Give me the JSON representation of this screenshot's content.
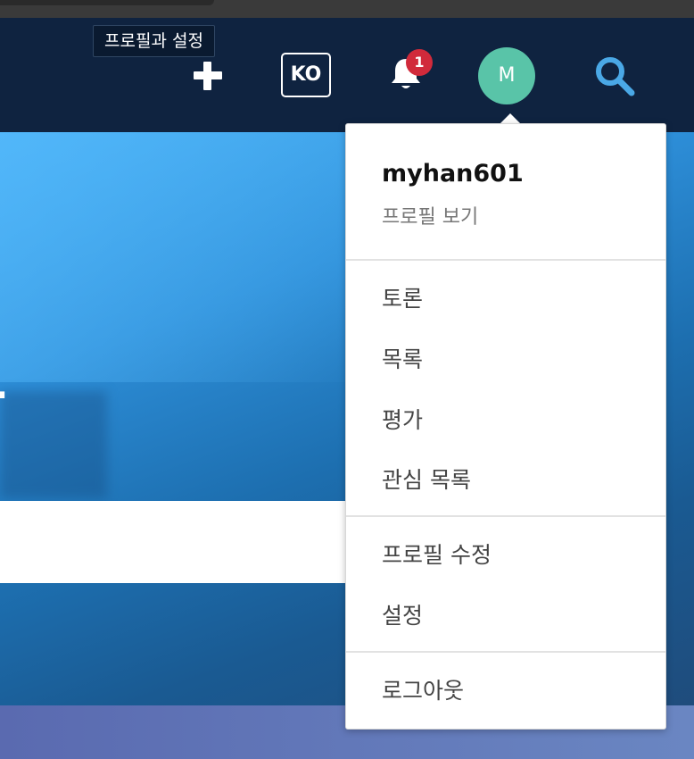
{
  "tooltip": {
    "text": "프로필과 설정"
  },
  "navbar": {
    "language_label": "KO",
    "notification_count": "1",
    "avatar_initial": "M",
    "colors": {
      "background": "#0f2340",
      "avatar": "#59c4a8",
      "badge": "#d12a3b",
      "search": "#4aa8e6"
    },
    "icons": [
      "plus-icon",
      "bell-icon",
      "search-icon"
    ]
  },
  "hero": {
    "visible_fragment": "."
  },
  "dropdown": {
    "username": "myhan601",
    "profile_link": "프로필 보기",
    "group1": [
      "토론",
      "목록",
      "평가",
      "관심 목록"
    ],
    "group2": [
      "프로필 수정",
      "설정"
    ],
    "logout": "로그아웃"
  }
}
